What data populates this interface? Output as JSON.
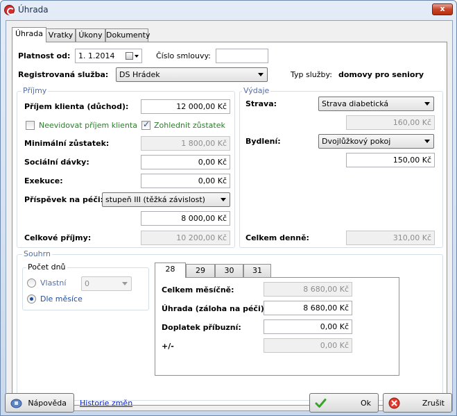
{
  "window": {
    "title": "Úhrada",
    "close_label": "x"
  },
  "tabs": [
    "Úhrada",
    "Vratky",
    "Úkony",
    "Dokumenty"
  ],
  "header": {
    "platnost_label": "Platnost od:",
    "platnost_value": "1.  1.2014",
    "cislo_label": "Číslo smlouvy:",
    "cislo_value": "",
    "sluzba_label": "Registrovaná služba:",
    "sluzba_value": "DS Hrádek",
    "typ_label": "Typ služby:",
    "typ_value": "domovy pro seniory"
  },
  "prijmy": {
    "legend": "Příjmy",
    "prijem_label": "Příjem klienta (důchod):",
    "prijem_value": "12 000,00 Kč",
    "neevidovat_label": "Neevidovat příjem klienta",
    "zohlednit_label": "Zohlednit zůstatek",
    "minimalni_label": "Minimální zůstatek:",
    "minimalni_value": "1 800,00 Kč",
    "socialni_label": "Sociální dávky:",
    "socialni_value": "0,00 Kč",
    "exekuce_label": "Exekuce:",
    "exekuce_value": "0,00 Kč",
    "prispevek_label": "Příspěvek na péči:",
    "prispevek_select": "stupeň III (těžká závislost)",
    "prispevek_value": "8 000,00 Kč",
    "celkove_label": "Celkové příjmy:",
    "celkove_value": "10 200,00 Kč"
  },
  "vydaje": {
    "legend": "Výdaje",
    "strava_label": "Strava:",
    "strava_select": "Strava diabetická",
    "strava_value": "160,00 Kč",
    "bydleni_label": "Bydlení:",
    "bydleni_select": "Dvojlůžkový pokoj",
    "bydleni_value": "150,00 Kč",
    "celkem_label": "Celkem denně:",
    "celkem_value": "310,00 Kč"
  },
  "souhrn": {
    "legend": "Souhrn",
    "pocet_legend": "Počet dnů",
    "vlastni_label": "Vlastní",
    "vlastni_value": "0",
    "dle_label": "Dle měsíce",
    "day_tabs": [
      "28",
      "29",
      "30",
      "31"
    ],
    "mesicne_label": "Celkem měsíčně:",
    "mesicne_value": "8 680,00 Kč",
    "uhrada_label": "Úhrada (záloha na péči):",
    "uhrada_value": "8 680,00 Kč",
    "doplatek_label": "Doplatek příbuzní:",
    "doplatek_value": "0,00 Kč",
    "plusminus_label": "+/-",
    "plusminus_value": "0,00 Kč"
  },
  "footer": {
    "napoveda_label": "Nápověda",
    "historie_label": "Historie změn",
    "ok_label": "Ok",
    "zrusit_label": "Zrušit"
  },
  "colors": {
    "accent": "#566ea2",
    "green_label": "#2b7d2b",
    "link": "#0b22c4"
  }
}
